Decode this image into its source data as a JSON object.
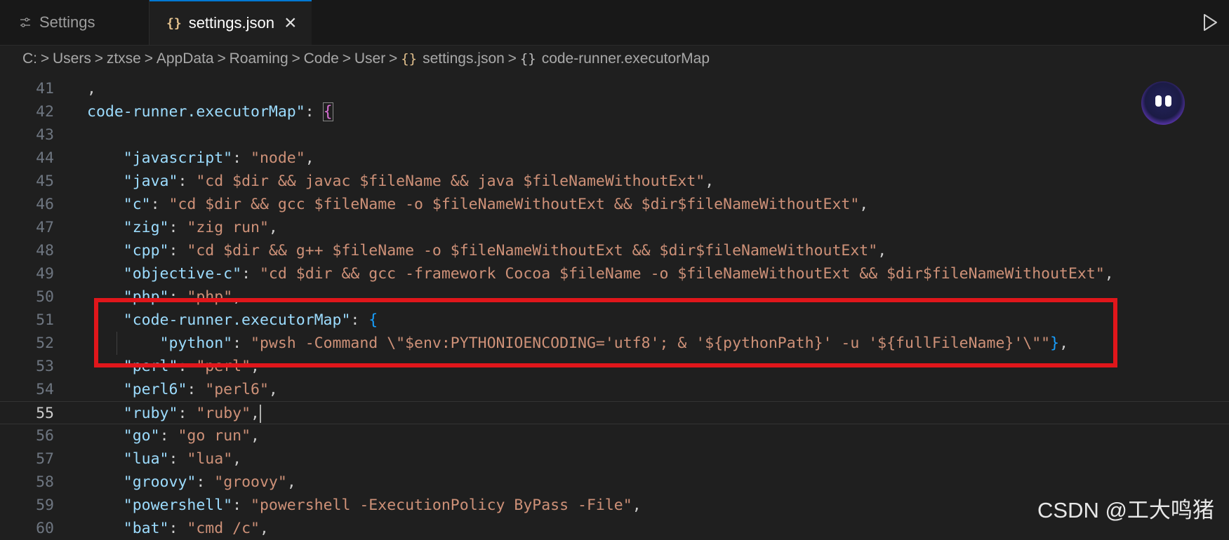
{
  "tabs": [
    {
      "label": "Settings",
      "icon": "settings-sliders-icon",
      "active": false
    },
    {
      "label": "settings.json",
      "icon": "json-braces-icon",
      "active": true,
      "close_glyph": "×"
    }
  ],
  "run_button_icon": "run-triangle-icon",
  "breadcrumb": [
    "C:",
    "Users",
    "ztxse",
    "AppData",
    "Roaming",
    "Code",
    "User",
    "settings.json",
    "code-runner.executorMap"
  ],
  "editor": {
    "active_line": 55,
    "lines": [
      {
        "n": "41",
        "t": ","
      },
      {
        "n": "42",
        "t": "code-runner.executorMap\": {"
      },
      {
        "n": "43",
        "t": ""
      },
      {
        "n": "44",
        "t": "    \"javascript\": \"node\","
      },
      {
        "n": "45",
        "t": "    \"java\": \"cd $dir && javac $fileName && java $fileNameWithoutExt\","
      },
      {
        "n": "46",
        "t": "    \"c\": \"cd $dir && gcc $fileName -o $fileNameWithoutExt && $dir$fileNameWithoutExt\","
      },
      {
        "n": "47",
        "t": "    \"zig\": \"zig run\","
      },
      {
        "n": "48",
        "t": "    \"cpp\": \"cd $dir && g++ $fileName -o $fileNameWithoutExt && $dir$fileNameWithoutExt\","
      },
      {
        "n": "49",
        "t": "    \"objective-c\": \"cd $dir && gcc -framework Cocoa $fileName -o $fileNameWithoutExt && $dir$fileNameWithoutExt\","
      },
      {
        "n": "50",
        "t": "    \"php\": \"php\","
      },
      {
        "n": "51",
        "t": "    \"code-runner.executorMap\": {"
      },
      {
        "n": "52",
        "t": "        \"python\": \"pwsh -Command \\\"$env:PYTHONIOENCODING='utf8'; & '${pythonPath}' -u '${fullFileName}'\\\"\"},"
      },
      {
        "n": "53",
        "t": "    \"perl\": \"perl\","
      },
      {
        "n": "54",
        "t": "    \"perl6\": \"perl6\","
      },
      {
        "n": "55",
        "t": "    \"ruby\": \"ruby\","
      },
      {
        "n": "56",
        "t": "    \"go\": \"go run\","
      },
      {
        "n": "57",
        "t": "    \"lua\": \"lua\","
      },
      {
        "n": "58",
        "t": "    \"groovy\": \"groovy\","
      },
      {
        "n": "59",
        "t": "    \"powershell\": \"powershell -ExecutionPolicy ByPass -File\","
      },
      {
        "n": "60",
        "t": "    \"bat\": \"cmd /c\","
      }
    ]
  },
  "colors": {
    "background": "#1f1f1f",
    "json_key": "#9cdcfe",
    "json_string": "#ce9178",
    "bracket_level1": "#da70d6",
    "bracket_level2": "#179fff",
    "annotation_box": "#e0161b"
  },
  "watermark": "CSDN @工大鸣猪"
}
